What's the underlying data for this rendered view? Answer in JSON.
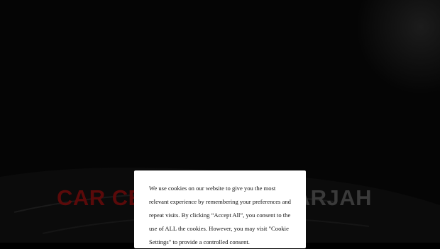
{
  "hero": {
    "title_part1": "CAR CE",
    "title_part2": "HARJAH"
  },
  "cookie_banner": {
    "message": "We use cookies on our website to give you the most relevant experience by remembering your preferences and repeat visits. By clicking “Accept All”, you consent to the use of ALL the cookies. However, you may visit \"Cookie Settings\" to provide a controlled consent."
  },
  "colors": {
    "background": "#000000",
    "title_accent": "#5a0a0a",
    "banner_bg": "#ffffff"
  }
}
